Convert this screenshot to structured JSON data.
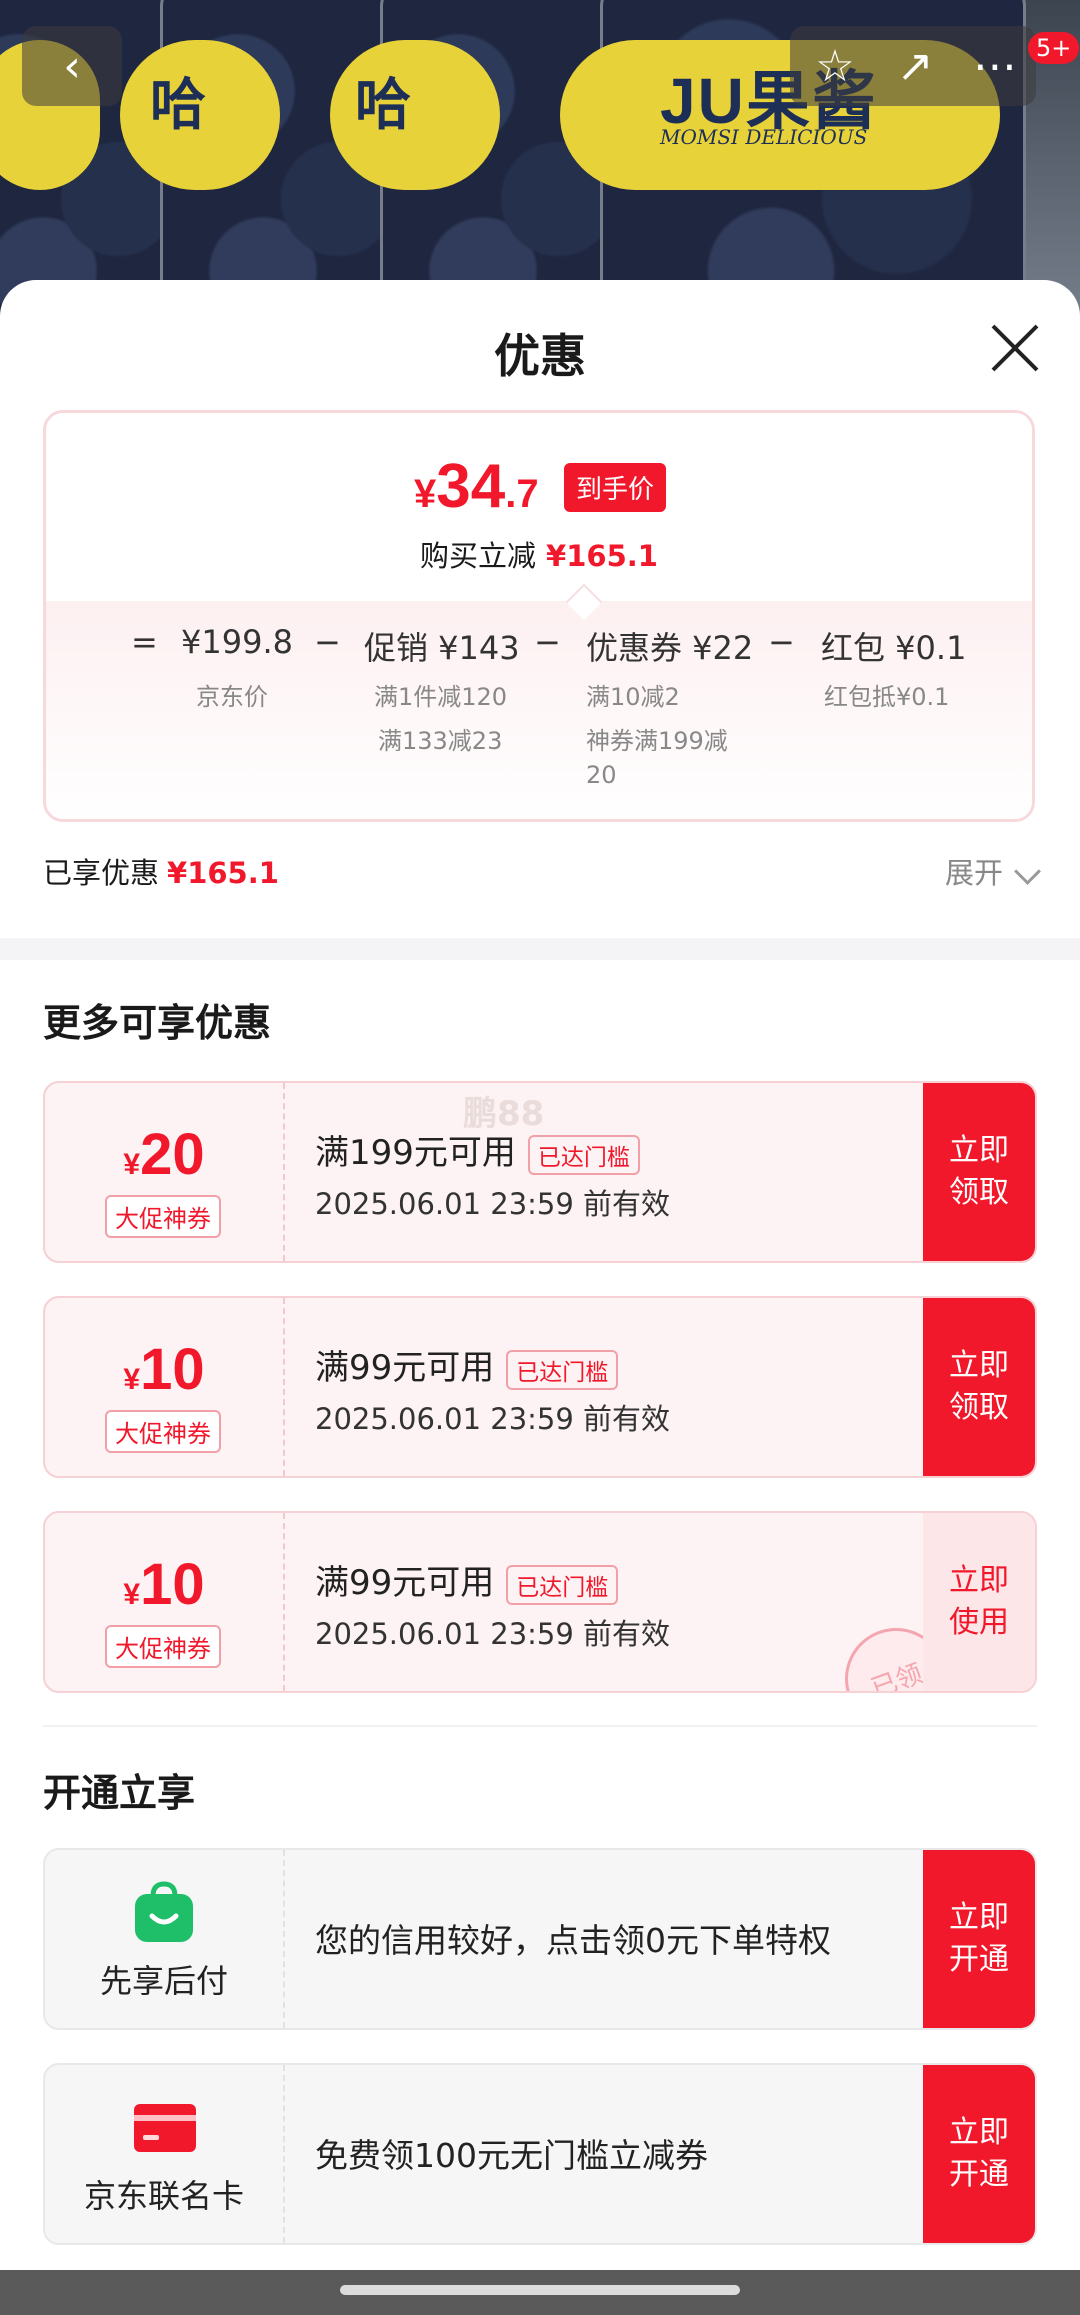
{
  "header": {
    "brand_text": "JU果酱",
    "brand_sub": "MOMSI DELICIOUS",
    "label_fragment": "哈",
    "badge": "5+",
    "back_glyph": "‹",
    "star_glyph": "☆",
    "share_glyph": "↗",
    "more_glyph": "⋯"
  },
  "sheet": {
    "title": "优惠",
    "close_glyph": "×"
  },
  "price_card": {
    "currency": "¥",
    "price_int": "34",
    "price_dec": ".7",
    "price_tag": "到手价",
    "save_label": "购买立减",
    "save_value": "¥165.1",
    "breakdown": {
      "eq": "=",
      "jd_price": "¥199.8",
      "jd_label": "京东价",
      "minus1": "−",
      "promo": "促销 ¥143",
      "promo_sub1": "满1件减120",
      "promo_sub2": "满133减23",
      "minus2": "−",
      "coupon": "优惠券 ¥22",
      "coupon_sub1": "满10减2",
      "coupon_sub2": "神券满199减",
      "coupon_sub3": "20",
      "minus3": "−",
      "redpack": "红包 ¥0.1",
      "redpack_sub": "红包抵¥0.1"
    }
  },
  "enjoyed": {
    "label": "已享优惠",
    "value": "¥165.1",
    "expand": "展开"
  },
  "more": {
    "title": "更多可享优惠",
    "watermark": "鹏88",
    "coupons": [
      {
        "symbol": "¥",
        "amount": "20",
        "tag": "大促神券",
        "condition": "满199元可用",
        "reach": "已达门槛",
        "date": "2025.06.01 23:59 前有效",
        "action": "立即领取"
      },
      {
        "symbol": "¥",
        "amount": "10",
        "tag": "大促神券",
        "condition": "满99元可用",
        "reach": "已达门槛",
        "date": "2025.06.01 23:59 前有效",
        "action": "立即领取"
      },
      {
        "symbol": "¥",
        "amount": "10",
        "tag": "大促神券",
        "condition": "满99元可用",
        "reach": "已达门槛",
        "date": "2025.06.01 23:59 前有效",
        "action": "立即使用",
        "stamp": "已领"
      }
    ]
  },
  "open": {
    "title": "开通立享",
    "services": [
      {
        "icon": "shopping-bag-icon",
        "label": "先享后付",
        "text": "您的信用较好，点击领0元下单特权",
        "action": "立即开通"
      },
      {
        "icon": "credit-card-icon",
        "label": "京东联名卡",
        "text": "免费领100元无门槛立减券",
        "action": "立即开通"
      }
    ]
  },
  "colors": {
    "accent": "#f2182b",
    "green": "#1fbf6a"
  }
}
